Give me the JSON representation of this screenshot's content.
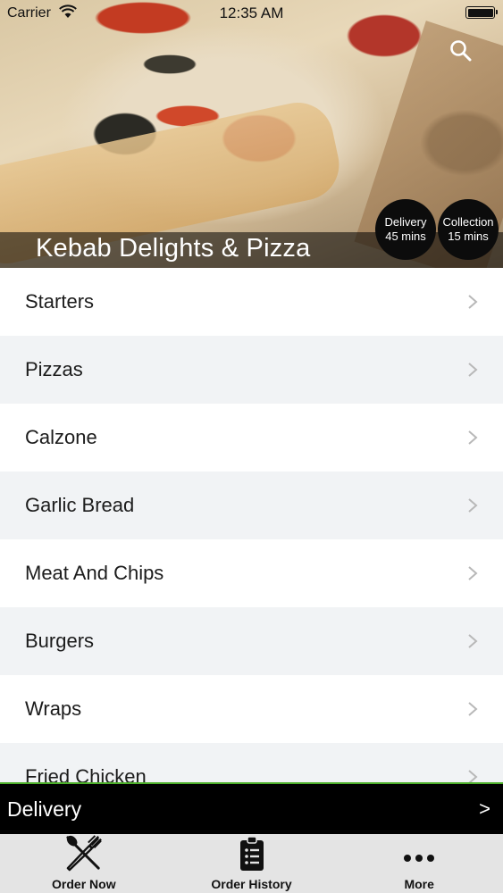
{
  "status_bar": {
    "carrier": "Carrier",
    "time": "12:35 AM"
  },
  "hero": {
    "restaurant_name": "Kebab Delights & Pizza",
    "delivery_badge": {
      "label": "Delivery",
      "time": "45 mins"
    },
    "collection_badge": {
      "label": "Collection",
      "time": "15 mins"
    }
  },
  "categories": [
    {
      "label": "Starters"
    },
    {
      "label": "Pizzas"
    },
    {
      "label": "Calzone"
    },
    {
      "label": "Garlic Bread"
    },
    {
      "label": "Meat And Chips"
    },
    {
      "label": "Burgers"
    },
    {
      "label": "Wraps"
    },
    {
      "label": "Fried Chicken"
    }
  ],
  "delivery_bar": {
    "label": "Delivery",
    "arrow": ">"
  },
  "tabs": [
    {
      "label": "Order Now",
      "icon": "fork-knife-icon"
    },
    {
      "label": "Order History",
      "icon": "clipboard-list-icon"
    },
    {
      "label": "More",
      "icon": "more-dots-icon"
    }
  ],
  "colors": {
    "accent_line": "#4caf2a",
    "delivery_bar_bg": "#000000",
    "tabbar_bg": "#e4e4e4",
    "row_alt_bg": "#f1f3f5"
  }
}
